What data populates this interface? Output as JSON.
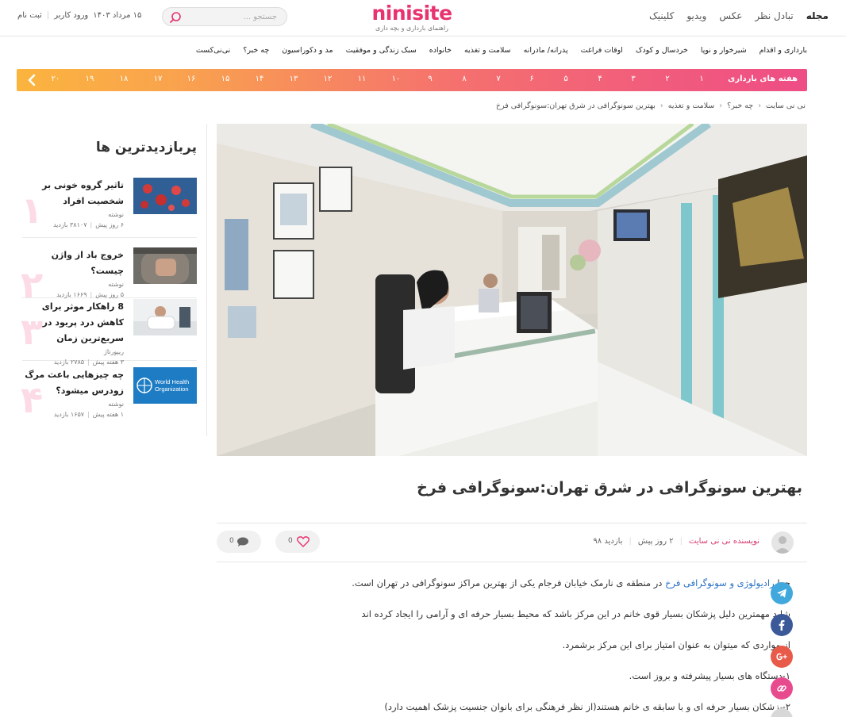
{
  "header": {
    "nav": [
      "مجله",
      "تبادل نظر",
      "عکس",
      "ویدیو",
      "کلینیک"
    ],
    "logo_name": "ninisite",
    "logo_tagline": "راهنمای بارداری و بچه داری",
    "search_placeholder": "جستجو ...",
    "date": "۱۵ مرداد ۱۴۰۳",
    "login": "ورود کاربر",
    "signup": "ثبت نام"
  },
  "subnav": [
    "بارداری و اقدام",
    "شیرخوار و نوپا",
    "خردسال و کودک",
    "اوقات فراغت",
    "پدرانه/ مادرانه",
    "سلامت و تغذیه",
    "خانواده",
    "سبک زندگی و موفقیت",
    "مد و دکوراسیون",
    "چه خبر؟",
    "نی‌نی‌کست"
  ],
  "weeks": {
    "label": "هفته های بارداری",
    "items": [
      "۱",
      "۲",
      "۳",
      "۴",
      "۵",
      "۶",
      "۷",
      "۸",
      "۹",
      "۱۰",
      "۱۱",
      "۱۲",
      "۱۳",
      "۱۴",
      "۱۵",
      "۱۶",
      "۱۷",
      "۱۸",
      "۱۹",
      "۲۰"
    ]
  },
  "breadcrumb": [
    "نی نی سایت",
    "چه خبر؟",
    "سلامت و تغذیه",
    "بهترین سونوگرافی در شرق تهران:سونوگرافی فرخ"
  ],
  "sidebar": {
    "title": "پربازدیدترین ها",
    "items": [
      {
        "num": "۱",
        "title": "تاثیر گروه خونی بر شخصیت افراد",
        "author": "نوشته",
        "time": "۶ روز پیش",
        "views": "۳۸۱۰۷ بازدید"
      },
      {
        "num": "۲",
        "title": "خروج باد از واژن چیست؟",
        "author": "نوشته",
        "time": "۵ روز پیش",
        "views": "۱۶۶۹ بازدید"
      },
      {
        "num": "۳",
        "title": "8 راهکار موثر برای کاهش درد پریود در سریع‌ترین زمان",
        "author": "ریپورتاژ",
        "time": "۳ هفته پیش",
        "views": "۲۷۸۵ بازدید"
      },
      {
        "num": "۴",
        "title": "چه چیزهایی باعث مرگ زودرس میشود؟",
        "author": "نوشته",
        "time": "۱ هفته پیش",
        "views": "۱۶۵۷ بازدید"
      }
    ],
    "who_label_1": "World Health",
    "who_label_2": "Organization"
  },
  "article": {
    "title": "بهترین سونوگرافی در شرق تهران:سونوگرافی فرخ",
    "author": "نویسنده نی نی سایت",
    "time": "۲ روز پیش",
    "views": "بازدید ۹۸",
    "likes": "0",
    "comments": "0",
    "p1_before": "چرا ",
    "p1_link": "رادیولوژی و سونوگرافی فرخ",
    "p1_after": " در منطقه ی نارمک خیابان فرجام یکی از بهترین مراکز سونوگرافی در تهران است.",
    "p2": "شاید مهمترین دلیل پزشکان بسیار قوی خانم در این مرکز باشد که محیط بسیار حرفه ای و آرامی را ایجاد کرده اند",
    "p3": "از مواردی که میتوان به عنوان امتیاز برای این مرکز برشمرد.",
    "p4": "۱-دستگاه های بسیار پیشرفته و بروز است.",
    "p5": "۲-پزشکان بسیار حرفه ای و با سابقه ی خانم هستند(از نظر فرهنگی برای بانوان جنسیت پزشک اهمیت دارد)"
  },
  "colors": {
    "brand": "#e8336e",
    "link": "#2a72c6",
    "telegram": "#40a8dc",
    "facebook": "#3b5998",
    "googleplus": "#e85b4b",
    "copylink": "#e84a8e"
  }
}
